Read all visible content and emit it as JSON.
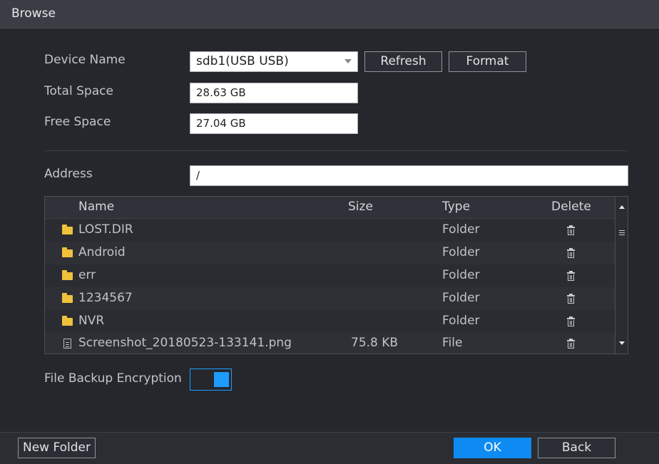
{
  "window": {
    "title": "Browse"
  },
  "device": {
    "name_label": "Device Name",
    "name_value": "sdb1(USB USB)",
    "refresh_label": "Refresh",
    "format_label": "Format",
    "total_label": "Total Space",
    "total_value": "28.63 GB",
    "free_label": "Free Space",
    "free_value": "27.04 GB"
  },
  "address": {
    "label": "Address",
    "value": "/"
  },
  "table": {
    "headers": {
      "name": "Name",
      "size": "Size",
      "type": "Type",
      "delete": "Delete"
    },
    "rows": [
      {
        "name": "LOST.DIR",
        "size": "",
        "type": "Folder",
        "icon": "folder-icon"
      },
      {
        "name": "Android",
        "size": "",
        "type": "Folder",
        "icon": "folder-icon"
      },
      {
        "name": "err",
        "size": "",
        "type": "Folder",
        "icon": "folder-icon"
      },
      {
        "name": "1234567",
        "size": "",
        "type": "Folder",
        "icon": "folder-icon"
      },
      {
        "name": "NVR",
        "size": "",
        "type": "Folder",
        "icon": "folder-icon"
      },
      {
        "name": "Screenshot_20180523-133141.png",
        "size": "75.8 KB",
        "type": "File",
        "icon": "file-icon"
      }
    ]
  },
  "encryption": {
    "label": "File Backup Encryption",
    "enabled": true
  },
  "footer": {
    "new_folder_label": "New Folder",
    "ok_label": "OK",
    "back_label": "Back"
  },
  "colors": {
    "accent": "#0d8bf2",
    "folder": "#f0c23b",
    "background": "#25272d"
  }
}
